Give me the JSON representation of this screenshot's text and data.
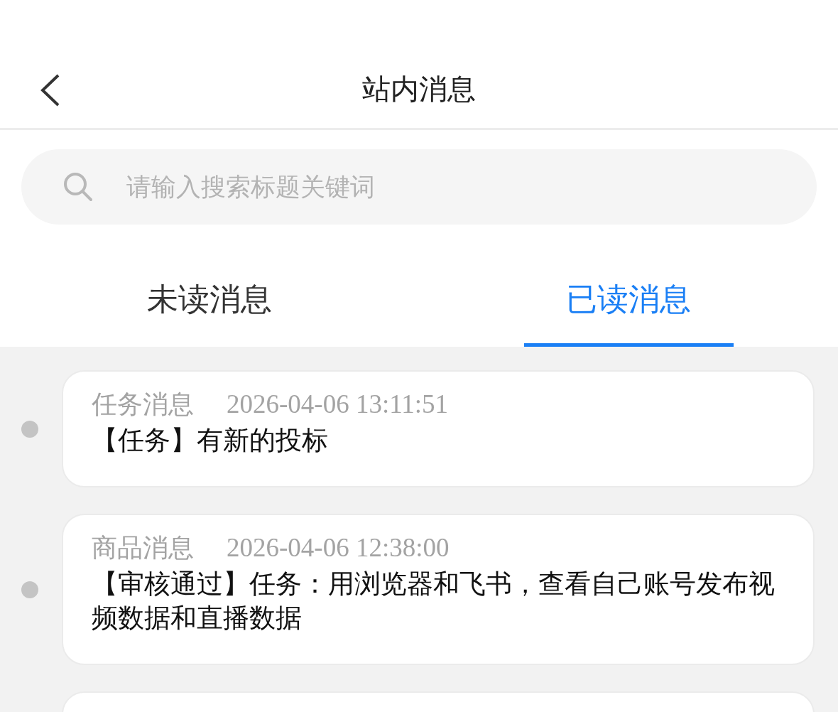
{
  "header": {
    "title": "站内消息"
  },
  "search": {
    "placeholder": "请输入搜索标题关键词"
  },
  "tabs": [
    {
      "label": "未读消息",
      "selected": false
    },
    {
      "label": "已读消息",
      "selected": true
    }
  ],
  "messages": [
    {
      "category": "任务消息",
      "time": "2026-04-06 13:11:51",
      "text": "【任务】有新的投标"
    },
    {
      "category": "商品消息",
      "time": "2026-04-06 12:38:00",
      "text": "【审核通过】任务：用浏览器和飞书，查看自己账号发布视频数据和直播数据"
    }
  ]
}
